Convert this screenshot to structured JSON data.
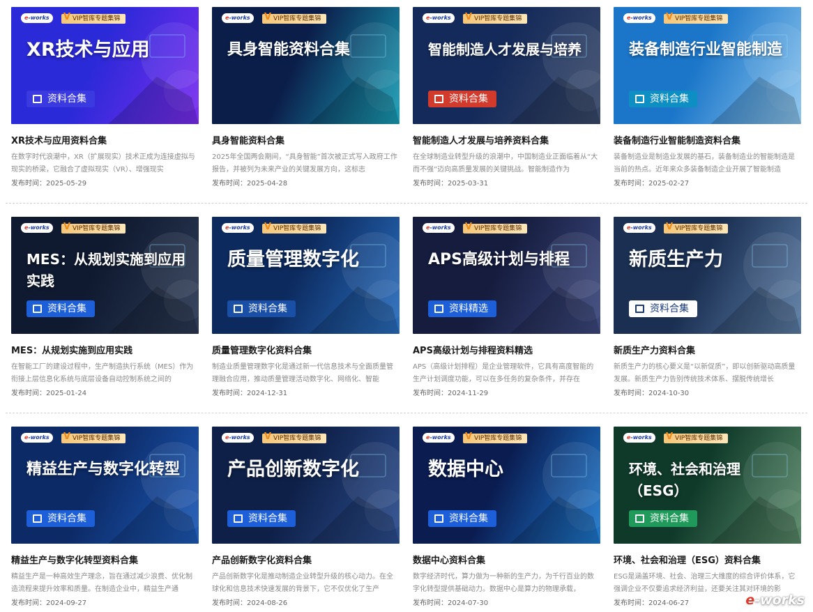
{
  "logo_text": "e-works",
  "vip_tag": "VIP智库专题集锦",
  "watermark": "e-works",
  "cards": [
    {
      "headline": "XR技术与应用",
      "badge": "资料合集",
      "title": "XR技术与应用资料合集",
      "desc": "在数字时代浪潮中，XR（扩展现实）技术正成为连接虚拟与现实的桥梁，它融合了虚拟现实（VR）、增强现实",
      "date": "发布时间：2025-05-29",
      "bg": "#2b2ad8",
      "bg2": "#7b2df0",
      "badge_color": "#3a3ae0"
    },
    {
      "headline": "具身智能资料合集",
      "badge": "",
      "title": "具身智能资料合集",
      "desc": "2025年全国两会期间，“具身智能”首次被正式写入政府工作报告，并被列为未来产业的关键发展方向，这标志",
      "date": "发布时间：2025-04-28",
      "bg": "#0b1e4a",
      "bg2": "#1aa0b8",
      "badge_color": "#1d5fd8"
    },
    {
      "headline": "智能制造人才发展与培养",
      "badge": "资料合集",
      "title": "智能制造人才发展与培养资料合集",
      "desc": "在全球制造业转型升级的浪潮中，中国制造业正面临着从“大而不强”迈向高质量发展的关键挑战。智能制造作为",
      "date": "发布时间：2025-03-31",
      "bg": "#142a5a",
      "bg2": "#3a4a6a",
      "badge_color": "#d23a2c"
    },
    {
      "headline": "装备制造行业智能制造",
      "badge": "资料合集",
      "title": "装备制造行业智能制造资料合集",
      "desc": "装备制造业是制造业发展的基石，装备制造业的智能制造是当前的热点。近年来众多装备制造企业开展了智能制造",
      "date": "发布时间：2025-02-27",
      "bg": "#1b76c9",
      "bg2": "#8ec6ee",
      "badge_color": "#0e8fc4"
    },
    {
      "headline": "MES：从规划实施到应用实践",
      "badge": "资料合集",
      "title": "MES：从规划实施到应用实践",
      "desc": "在智能工厂的建设过程中，生产制造执行系统（MES）作为衔接上层信息化系统与底层设备自动控制系统之间的",
      "date": "发布时间：2025-01-24",
      "bg": "#0f1a30",
      "bg2": "#2c3a55",
      "badge_color": "#1d5fd8"
    },
    {
      "headline": "质量管理数字化",
      "badge": "资料合集",
      "title": "质量管理数字化资料合集",
      "desc": "制造业质量管理数字化是通过新一代信息技术与全面质量管理融合应用，推动质量管理活动数字化、网络化、智能",
      "date": "发布时间：2024-12-31",
      "bg": "#0c2a5e",
      "bg2": "#2a6fc0",
      "badge_color": "#1a4fa8"
    },
    {
      "headline": "APS高级计划与排程",
      "badge": "资料精选",
      "title": "APS高级计划与排程资料精选",
      "desc": "APS（高级计划排程）是企业管理软件，它具有高度智能的生产计划调度功能，可以在多任务的复杂条件，并存在",
      "date": "发布时间：2024-11-29",
      "bg": "#151c3e",
      "bg2": "#3e4a80",
      "badge_color": "#1d5fd8"
    },
    {
      "headline": "新质生产力",
      "badge": "资料合集",
      "title": "新质生产力资料合集",
      "desc": "新质生产力的核心要义是“以新促质”，即以创新驱动高质量发展。新质生产力告别传统技术体系、摆脱传统增长",
      "date": "发布时间：2024-10-30",
      "bg": "#1a2f52",
      "bg2": "#5d7ea6",
      "badge_color": "#ffffff"
    },
    {
      "headline": "精益生产与数字化转型",
      "badge": "资料合集",
      "title": "精益生产与数字化转型资料合集",
      "desc": "精益生产是一种高效生产理念，旨在通过减少浪费、优化制造流程来提升效率和质量。在制造企业中，精益生产通",
      "date": "发布时间：2024-09-27",
      "bg": "#0c2a66",
      "bg2": "#1e5bb8",
      "badge_color": "#1d5fd8"
    },
    {
      "headline": "产品创新数字化",
      "badge": "资料合集",
      "title": "产品创新数字化资料合集",
      "desc": "产品创新数字化是推动制造企业转型升级的核心动力。在全球化和信息技术快速发展的背景下，它不仅优化了生产",
      "date": "发布时间：2024-08-26",
      "bg": "#0e2048",
      "bg2": "#2d4f90",
      "badge_color": "#1d5fd8"
    },
    {
      "headline": "数据中心",
      "badge": "资料合集",
      "title": "数据中心资料合集",
      "desc": "数字经济时代，算力做为一种新的生产力，为千行百业的数字化转型提供基础动力。数据中心是算力的物理承载，",
      "date": "发布时间：2024-07-30",
      "bg": "#0a1c50",
      "bg2": "#1f7ad0",
      "badge_color": "#1d5fd8"
    },
    {
      "headline": "环境、社会和治理（ESG）",
      "badge": "资料合集",
      "title": "环境、社会和治理（ESG）资料合集",
      "desc": "ESG是涵盖环境、社会、治理三大维度的综合评价体系，它强调企业不仅要追求经济利益，还要关注其对环境的影",
      "date": "发布时间：2024-06-27",
      "bg": "#0f3a2a",
      "bg2": "#5a8a6a",
      "badge_color": "#1f9a5a"
    }
  ]
}
